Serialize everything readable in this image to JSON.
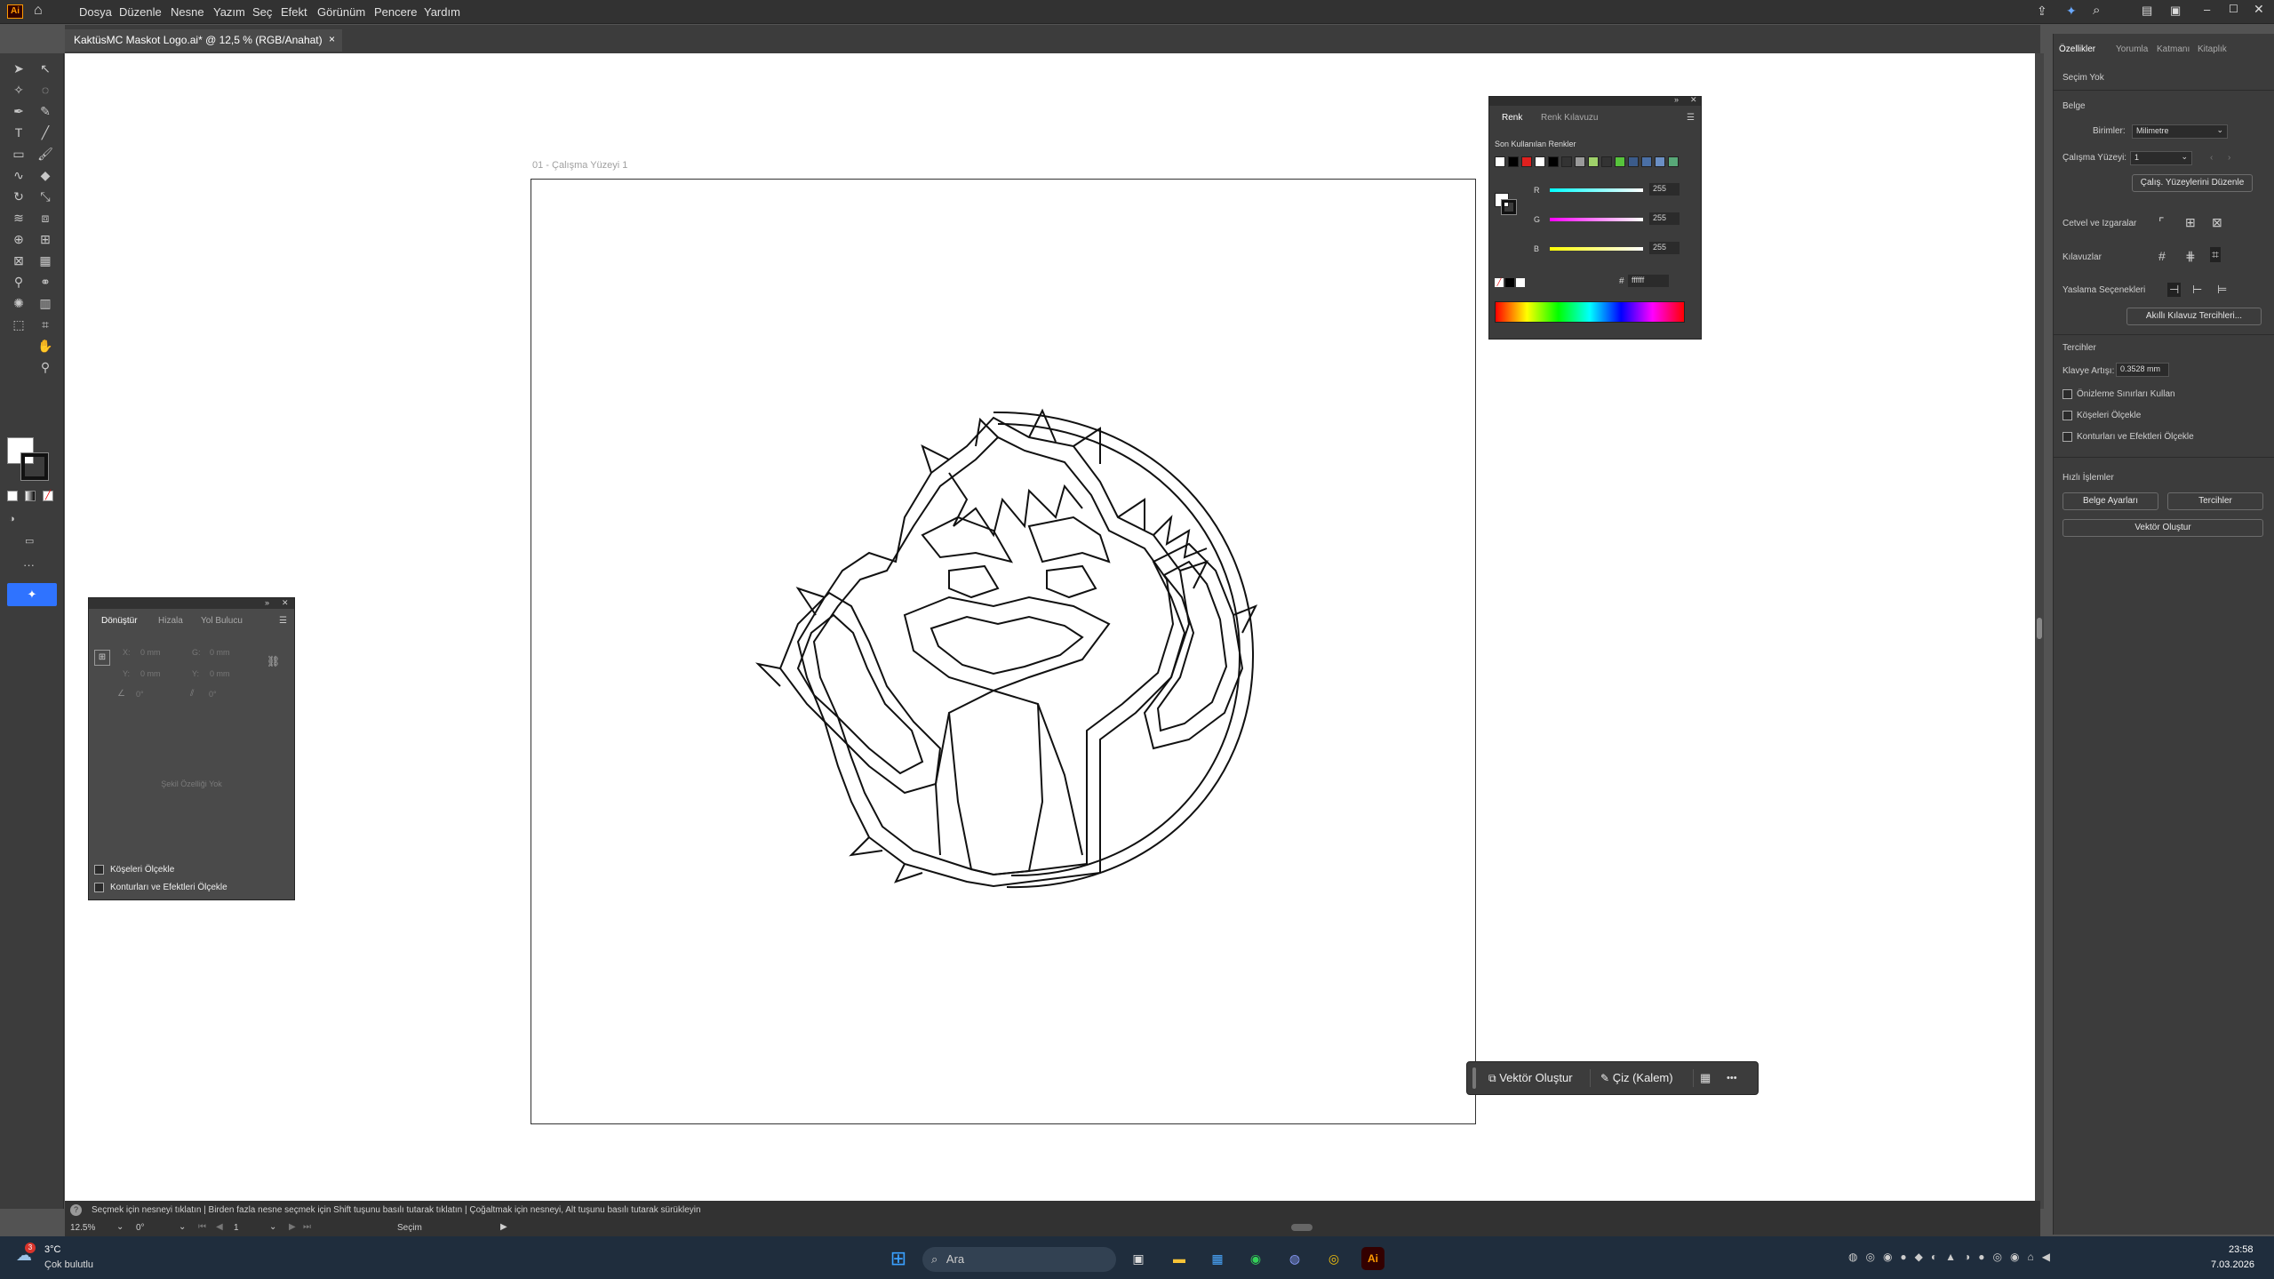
{
  "app": {
    "logo": "Ai",
    "menu": [
      "Dosya",
      "Düzenle",
      "Nesne",
      "Yazım",
      "Seç",
      "Efekt",
      "Görünüm",
      "Pencere",
      "Yardım"
    ],
    "doc_tab": "KaktüsMC Maskot Logo.ai* @ 12,5 % (RGB/Anahat)",
    "doc_tab_close": "×"
  },
  "canvas": {
    "artboard_label": "01 - Çalışma Yüzeyi 1"
  },
  "right_panel": {
    "tabs": [
      "Özellikler",
      "Yorumla",
      "Katmanı",
      "Kitaplık"
    ],
    "selection": "Seçim Yok",
    "document_header": "Belge",
    "units_label": "Birimler:",
    "units_value": "Milimetre",
    "artboard_label": "Çalışma Yüzeyi:",
    "artboard_value": "1",
    "edit_artboards": "Çalış. Yüzeylerini Düzenle",
    "rulers_grids": "Cetvel ve Izgaralar",
    "guides": "Kılavuzlar",
    "snap_options": "Yaslama Seçenekleri",
    "smart_guides_btn": "Akıllı Kılavuz Tercihleri...",
    "preferences_header": "Tercihler",
    "keyboard_increment_label": "Klavye Artışı:",
    "keyboard_increment_value": "0.3528 mm",
    "checkbox_preview_bounds": "Önizleme Sınırları Kullan",
    "checkbox_scale_corners": "Köşeleri Ölçekle",
    "checkbox_scale_strokes": "Konturları ve Efektleri Ölçekle",
    "quick_actions": "Hızlı İşlemler",
    "doc_setup_btn": "Belge Ayarları",
    "preferences_btn": "Tercihler",
    "vectorize_btn": "Vektör Oluştur"
  },
  "color_panel": {
    "tab_color": "Renk",
    "tab_guide": "Renk Kılavuzu",
    "recent_label": "Son Kullanılan Renkler",
    "r_label": "R",
    "g_label": "G",
    "b_label": "B",
    "r_value": "255",
    "g_value": "255",
    "b_value": "255",
    "hex_label": "#",
    "hex_value": "ffffff",
    "swatches": [
      "#ffffff",
      "#000000",
      "#e0201e",
      "#ffffff",
      "#000000",
      "#333333",
      "#9a9a9a",
      "#9fd16a",
      "#333333",
      "#57c43c",
      "#3b5b8a",
      "#4a6fa5",
      "#6b8fc4",
      "#58a878"
    ]
  },
  "transform_panel": {
    "tab_transform": "Dönüştür",
    "tab_align": "Hizala",
    "tab_pathfinder": "Yol Bulucu",
    "x_label": "X:",
    "x_value": "0 mm",
    "y_label": "Y:",
    "y_value": "0 mm",
    "w_label": "G:",
    "w_value": "0 mm",
    "h_label": "Y:",
    "h_value": "0 mm",
    "angle_value": "0°",
    "shear_value": "0°",
    "no_shape": "Şekil Özelliği Yok",
    "scale_corners": "Köşeleri Ölçekle",
    "scale_strokes": "Konturları ve Efektleri Ölçekle"
  },
  "floating_bar": {
    "vectorize": "Vektör Oluştur",
    "draw": "Çiz (Kalem)",
    "more": "•••"
  },
  "status": {
    "hint": "Seçmek için nesneyi tıklatın  |  Birden fazla nesne seçmek için Shift tuşunu basılı tutarak tıklatın  |  Çoğaltmak için nesneyi, Alt tuşunu basılı tutarak sürükleyin",
    "zoom": "12.5%",
    "rotation": "0°",
    "artboard_num": "1",
    "mode": "Seçim"
  },
  "taskbar": {
    "weather_temp": "3°C",
    "weather_desc": "Çok bulutlu",
    "weather_badge": "3",
    "search_placeholder": "Ara",
    "time": "23:58",
    "date": "7.03.2026"
  }
}
